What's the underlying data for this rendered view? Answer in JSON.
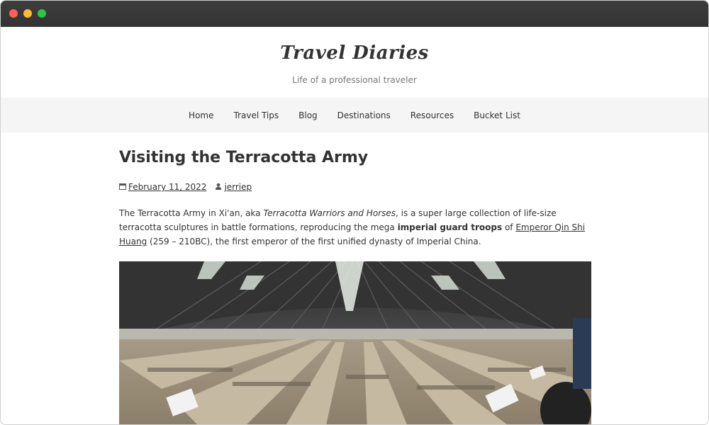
{
  "site": {
    "title": "Travel Diaries",
    "tagline": "Life of a professional traveler"
  },
  "nav": {
    "items": [
      "Home",
      "Travel Tips",
      "Blog",
      "Destinations",
      "Resources",
      "Bucket List"
    ]
  },
  "post": {
    "title": "Visiting the Terracotta Army",
    "date": "February 11, 2022",
    "author": "jerriep",
    "paragraph": {
      "part1": "The Terracotta Army in Xi'an, aka ",
      "italic": "Terracotta Warriors and Horses",
      "part2": ", is a super large collection of life-size terracotta sculptures in battle formations, reproducing the mega ",
      "bold": "imperial guard troops",
      "part3": " of ",
      "link": "Emperor Qin Shi Huang",
      "part4": " (259 – 210BC), the first emperor of the first unified dynasty of Imperial China."
    }
  },
  "icons": {
    "calendar": "calendar-icon",
    "author": "user-icon"
  },
  "colors": {
    "titlebar": "#333333",
    "nav_bg": "#f5f5f5",
    "text": "#333333"
  }
}
